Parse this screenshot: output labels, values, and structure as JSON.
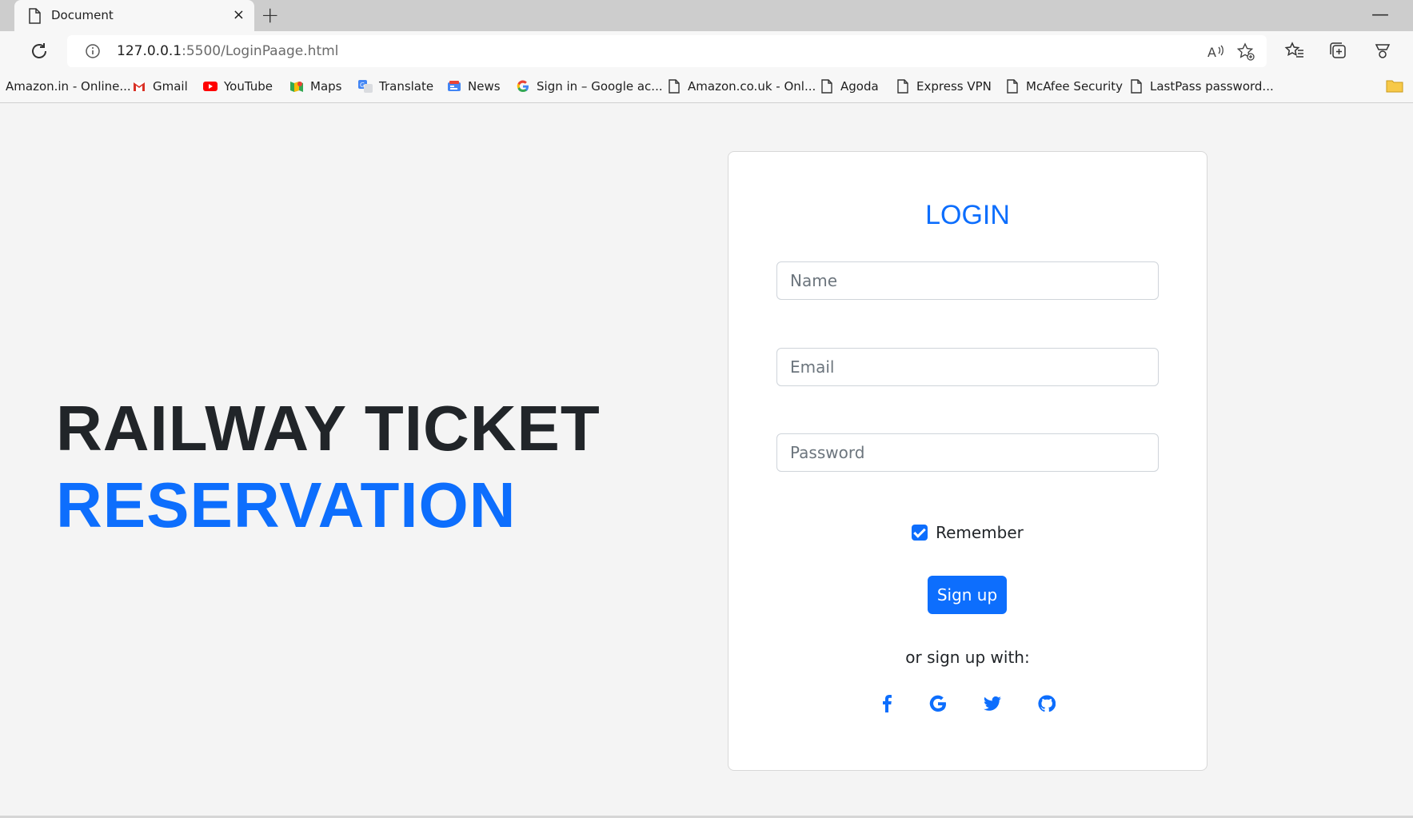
{
  "browser": {
    "tab_title": "Document",
    "url_host": "127.0.0.1",
    "url_rest": ":5500/LoginPaage.html",
    "tab_close_glyph": "×",
    "new_tab_glyph": "+",
    "minimize_glyph": "—"
  },
  "bookmarks": [
    {
      "label": "Amazon.in - Online...",
      "icon": "none"
    },
    {
      "label": "Gmail",
      "icon": "gmail-icon"
    },
    {
      "label": "YouTube",
      "icon": "youtube-icon"
    },
    {
      "label": "Maps",
      "icon": "maps-icon"
    },
    {
      "label": "Translate",
      "icon": "translate-icon"
    },
    {
      "label": "News",
      "icon": "news-icon"
    },
    {
      "label": "Sign in – Google ac...",
      "icon": "google-icon"
    },
    {
      "label": "Amazon.co.uk - Onl...",
      "icon": "page-icon"
    },
    {
      "label": "Agoda",
      "icon": "page-icon"
    },
    {
      "label": "Express VPN",
      "icon": "page-icon"
    },
    {
      "label": "McAfee Security",
      "icon": "page-icon"
    },
    {
      "label": "LastPass password...",
      "icon": "page-icon"
    }
  ],
  "hero": {
    "line1": "RAILWAY TICKET",
    "line2": "RESERVATION"
  },
  "login": {
    "title": "LOGIN",
    "name_placeholder": "Name",
    "email_placeholder": "Email",
    "password_placeholder": "Password",
    "remember_label": "Remember",
    "remember_checked": true,
    "signup_label": "Sign up",
    "alt_text": "or sign up with:",
    "social_icons": [
      "facebook-icon",
      "google-icon",
      "twitter-icon",
      "github-icon"
    ]
  },
  "colors": {
    "accent": "#0d6efd",
    "text": "#212529",
    "page_bg": "#f4f4f4"
  }
}
